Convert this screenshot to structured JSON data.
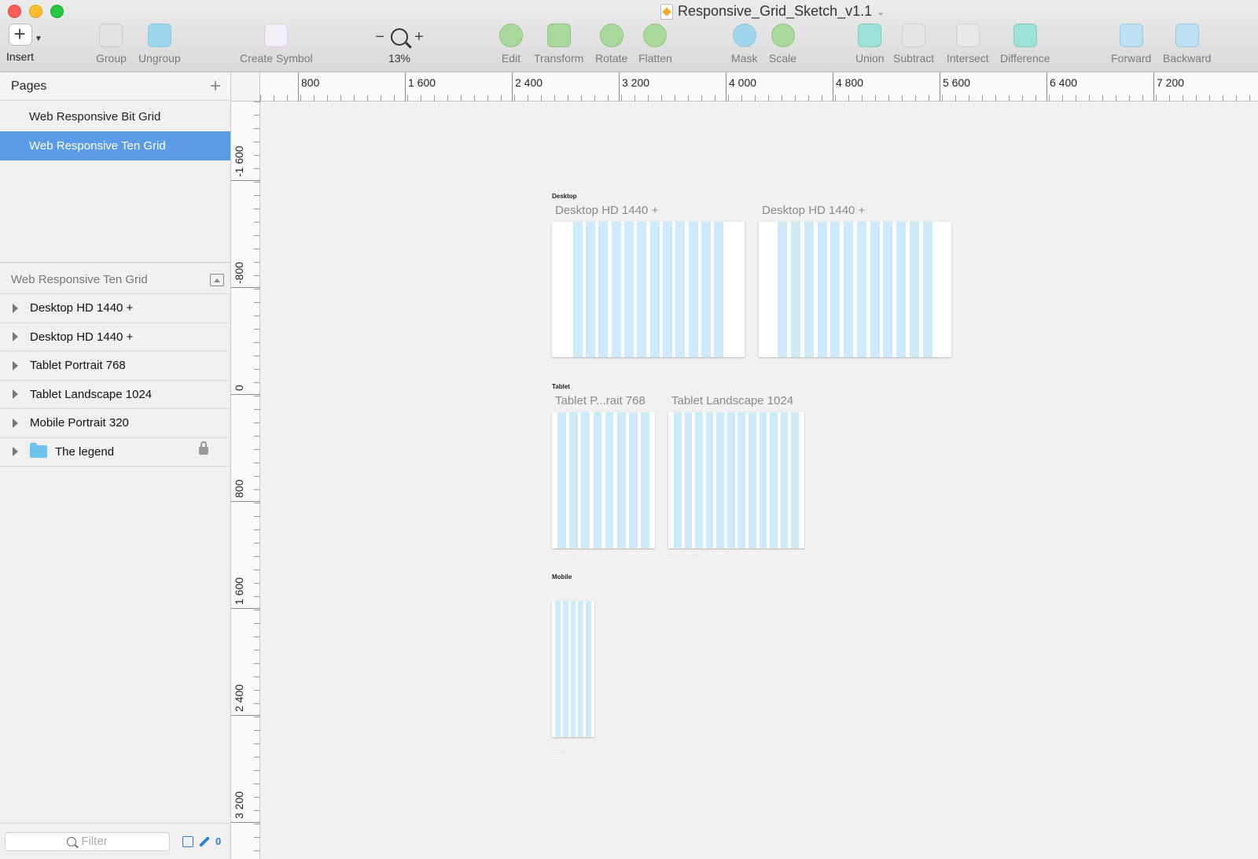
{
  "window": {
    "title": "Responsive_Grid_Sketch_v1.1"
  },
  "toolbar": {
    "insert": "Insert",
    "group": "Group",
    "ungroup": "Ungroup",
    "create_symbol": "Create Symbol",
    "zoom_minus": "−",
    "zoom_plus": "+",
    "zoom_level": "13%",
    "edit": "Edit",
    "transform": "Transform",
    "rotate": "Rotate",
    "flatten": "Flatten",
    "mask": "Mask",
    "scale": "Scale",
    "union": "Union",
    "subtract": "Subtract",
    "intersect": "Intersect",
    "difference": "Difference",
    "forward": "Forward",
    "backward": "Backward"
  },
  "sidebar": {
    "pages_title": "Pages",
    "add_page": "+",
    "pages": [
      {
        "label": "Web Responsive Bit Grid"
      },
      {
        "label": "Web Responsive Ten Grid"
      }
    ],
    "layers_title": "Web Responsive Ten Grid",
    "layers": [
      {
        "label": "Desktop HD 1440 +"
      },
      {
        "label": "Desktop HD 1440 +"
      },
      {
        "label": "Tablet Portrait 768"
      },
      {
        "label": "Tablet Landscape 1024"
      },
      {
        "label": "Mobile Portrait 320"
      },
      {
        "label": "The legend"
      }
    ],
    "filter_placeholder": "Filter",
    "filter_count": "0"
  },
  "rulers": {
    "top": [
      "800",
      "1 600",
      "2 400",
      "3 200",
      "4 000",
      "4 800",
      "5 600",
      "6 400",
      "7 200"
    ],
    "left": [
      "-1 600",
      "-800",
      "0",
      "800",
      "1 600",
      "2 400",
      "3 200"
    ]
  },
  "canvas": {
    "groups": {
      "desktop": "Desktop",
      "tablet": "Tablet",
      "mobile": "Mobile"
    },
    "artboards": {
      "desktop1": "Desktop HD 1440 +",
      "desktop2": "Desktop HD 1440 +",
      "tablet_portrait": "Tablet P...rait 768",
      "tablet_landscape": "Tablet Landscape 1024"
    }
  }
}
